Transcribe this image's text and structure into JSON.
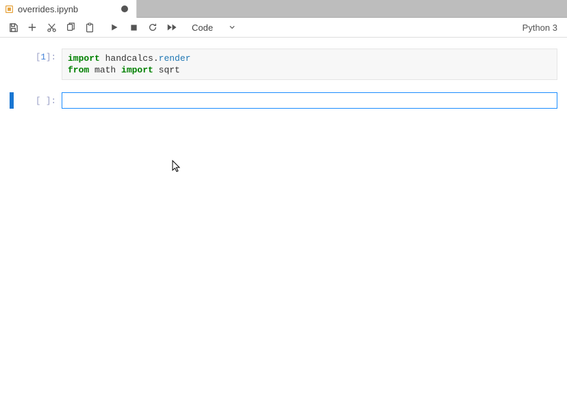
{
  "tab": {
    "title": "overrides.ipynb",
    "dirty": true
  },
  "toolbar": {
    "cell_type": "Code",
    "kernel": "Python 3"
  },
  "cells": [
    {
      "prompt_open": "[",
      "prompt_num": "1",
      "prompt_close": "]:",
      "code_tokens": [
        {
          "t": "import",
          "c": "kw"
        },
        {
          "t": " handcalcs.",
          "c": "nm"
        },
        {
          "t": "render",
          "c": "attr"
        },
        {
          "t": "\n",
          "c": ""
        },
        {
          "t": "from",
          "c": "kw"
        },
        {
          "t": " math ",
          "c": "nm"
        },
        {
          "t": "import",
          "c": "kw"
        },
        {
          "t": " sqrt",
          "c": "nm"
        }
      ]
    },
    {
      "prompt_open": "[",
      "prompt_num": " ",
      "prompt_close": "]:",
      "code_tokens": []
    }
  ]
}
